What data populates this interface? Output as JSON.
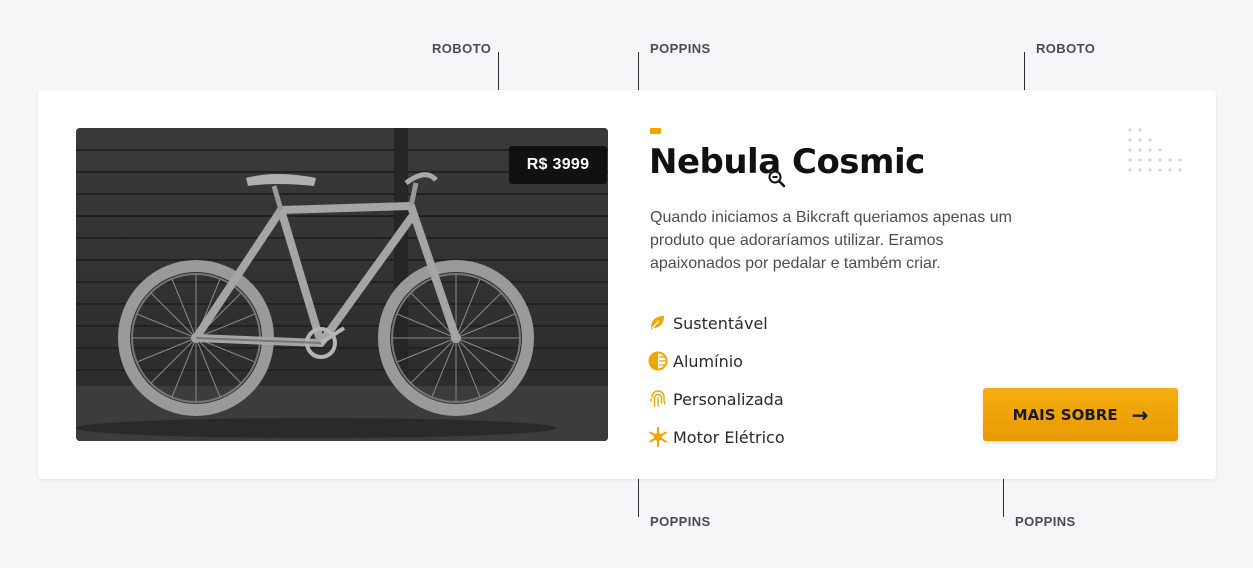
{
  "annotations": {
    "label_1": "ROBOTO",
    "label_2": "POPPINS",
    "label_3": "ROBOTO",
    "label_4": "POPPINS",
    "label_5": "POPPINS"
  },
  "product": {
    "price": "R$ 3999",
    "title": "Nebula Cosmic",
    "description": "Quando iniciamos a Bikcraft queriamos apenas um produto que adoraríamos utilizar. Eramos apaixonados por pedalar e também criar.",
    "image_icon": "bicycle-photo"
  },
  "features": [
    {
      "label": "Sustentável",
      "icon": "leaf-icon"
    },
    {
      "label": "Alumínio",
      "icon": "half-circle-icon"
    },
    {
      "label": "Personalizada",
      "icon": "fingerprint-icon"
    },
    {
      "label": "Motor Elétrico",
      "icon": "snowflake-icon"
    }
  ],
  "cta": {
    "label": "MAIS SOBRE",
    "arrow": "→"
  },
  "colors": {
    "accent": "#f0a500",
    "title": "#111111",
    "text": "#4d4d55",
    "background": "#f6f6f8",
    "card": "#ffffff"
  }
}
